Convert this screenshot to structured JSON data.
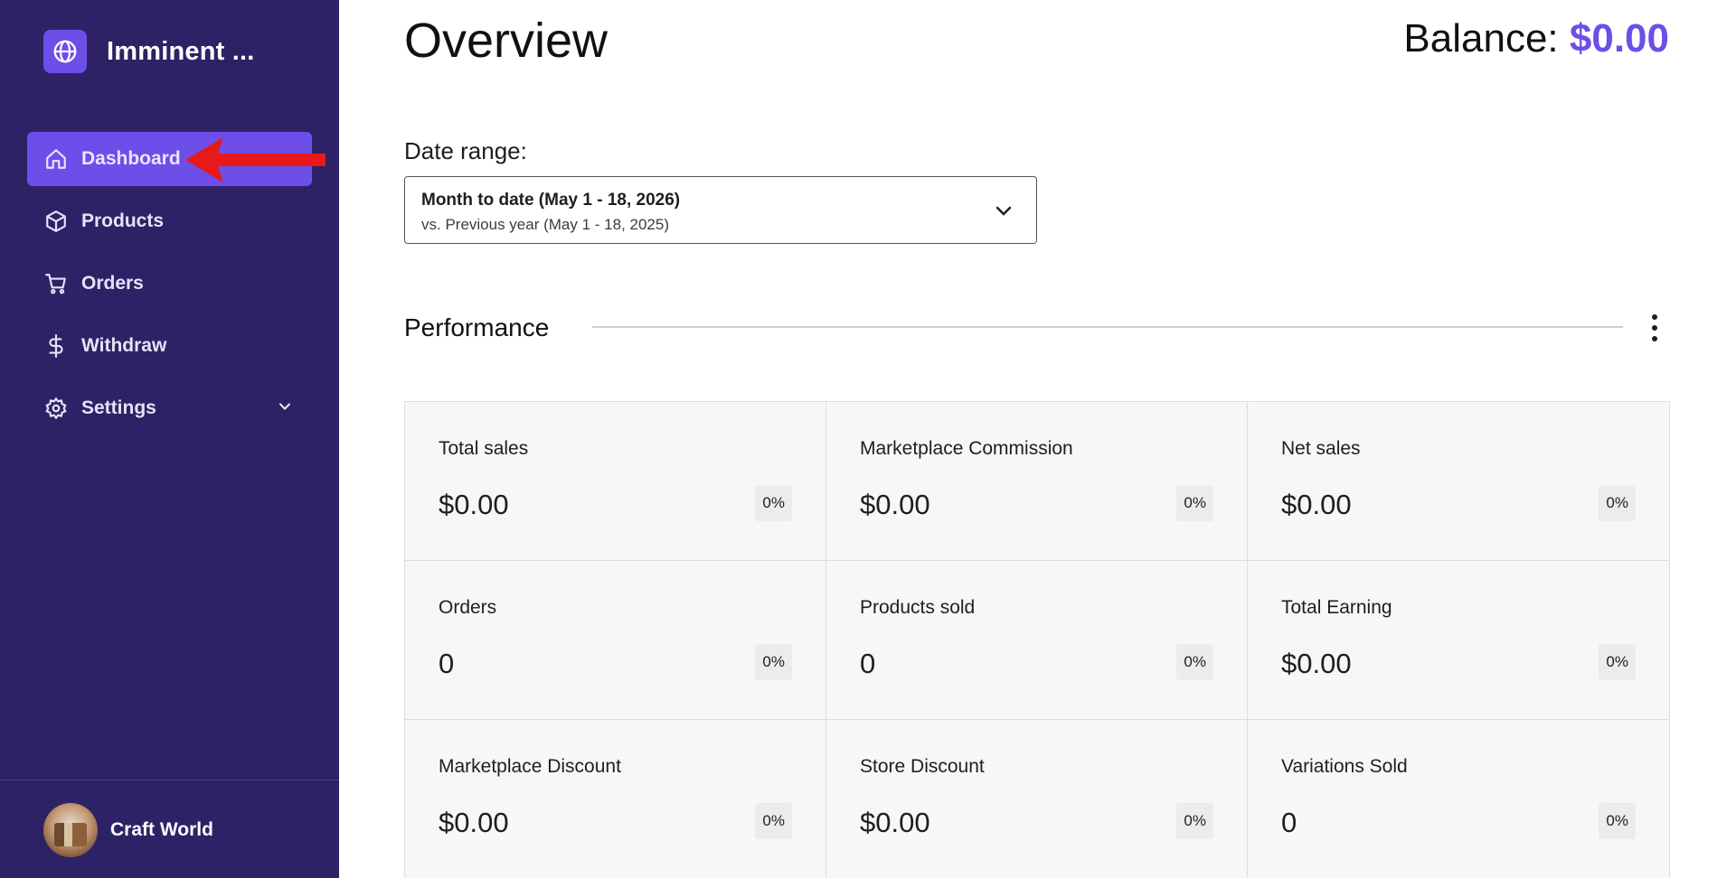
{
  "sidebar": {
    "brand_name": "Imminent ...",
    "brand_icon": "globe-icon",
    "items": [
      {
        "label": "Dashboard",
        "icon": "home-icon",
        "active": true
      },
      {
        "label": "Products",
        "icon": "box-icon"
      },
      {
        "label": "Orders",
        "icon": "cart-icon"
      },
      {
        "label": "Withdraw",
        "icon": "dollar-icon"
      },
      {
        "label": "Settings",
        "icon": "gear-icon",
        "has_submenu": true
      }
    ],
    "user_name": "Craft World"
  },
  "header": {
    "title": "Overview",
    "balance_label": "Balance:",
    "balance_amount": "$0.00"
  },
  "date_range": {
    "label": "Date range:",
    "primary": "Month to date (May 1 - 18, 2026)",
    "secondary": "vs. Previous year (May 1 - 18, 2025)"
  },
  "performance": {
    "title": "Performance",
    "cards": [
      {
        "label": "Total sales",
        "value": "$0.00",
        "delta": "0%"
      },
      {
        "label": "Marketplace Commission",
        "value": "$0.00",
        "delta": "0%"
      },
      {
        "label": "Net sales",
        "value": "$0.00",
        "delta": "0%"
      },
      {
        "label": "Orders",
        "value": "0",
        "delta": "0%"
      },
      {
        "label": "Products sold",
        "value": "0",
        "delta": "0%"
      },
      {
        "label": "Total Earning",
        "value": "$0.00",
        "delta": "0%"
      },
      {
        "label": "Marketplace Discount",
        "value": "$0.00",
        "delta": "0%"
      },
      {
        "label": "Store Discount",
        "value": "$0.00",
        "delta": "0%"
      },
      {
        "label": "Variations Sold",
        "value": "0",
        "delta": "0%"
      }
    ]
  },
  "colors": {
    "sidebar_bg": "#2e2266",
    "accent": "#6e4ee8",
    "annotation_arrow": "#e8191a"
  }
}
